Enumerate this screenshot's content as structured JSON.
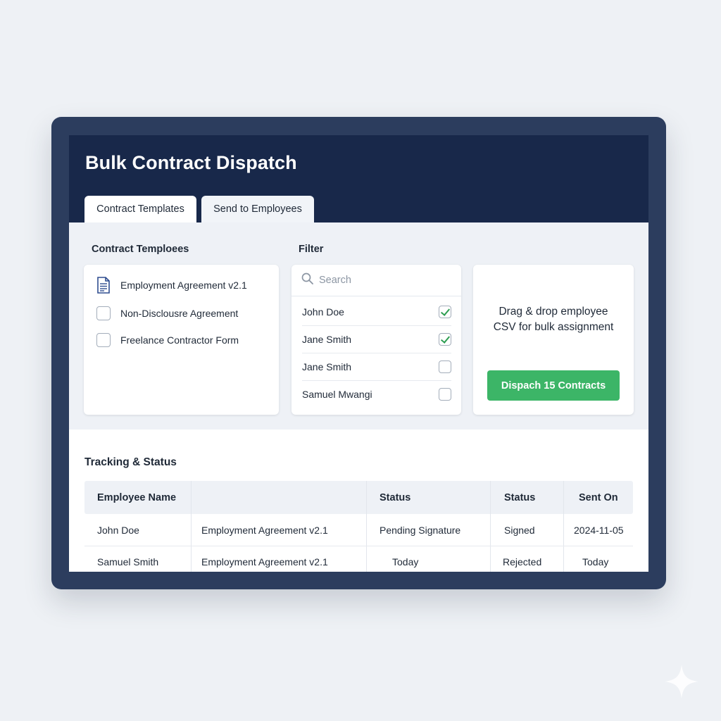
{
  "app": {
    "title": "Bulk Contract Dispatch"
  },
  "tabs": [
    {
      "label": "Contract Templates"
    },
    {
      "label": "Send to Employees"
    }
  ],
  "templates": {
    "heading": "Contract Temploees",
    "items": [
      {
        "label": "Employment Agreement v2.1",
        "icon": "document-icon"
      },
      {
        "label": "Non-Disclousre Agreement",
        "checked": false
      },
      {
        "label": "Freelance Contractor Form",
        "checked": false
      }
    ]
  },
  "filter": {
    "heading": "Filter",
    "search_placeholder": "Search",
    "employees": [
      {
        "name": "John Doe",
        "checked": true
      },
      {
        "name": "Jane Smith",
        "checked": true
      },
      {
        "name": "Jane Smith",
        "checked": false
      },
      {
        "name": "Samuel Mwangi",
        "checked": false
      }
    ]
  },
  "dropzone": {
    "line1": "Drag & drop employee",
    "line2": "CSV for bulk assignment",
    "button_label": "Dispach 15 Contracts"
  },
  "tracking": {
    "heading": "Tracking & Status",
    "columns": [
      "Employee Name",
      "",
      "Status",
      "Status",
      "Sent On"
    ],
    "rows": [
      [
        "John Doe",
        "Employment Agreement v2.1",
        "Pending Signature",
        "Signed",
        "2024-11-05"
      ],
      [
        "Samuel Smith",
        "Employment Agreement v2.1",
        "Today",
        "Rejected",
        "Today"
      ]
    ]
  },
  "colors": {
    "header_bg": "#18284a",
    "frame": "#2c3d5e",
    "accent_green": "#3cb567",
    "check_green": "#2e9e52"
  }
}
